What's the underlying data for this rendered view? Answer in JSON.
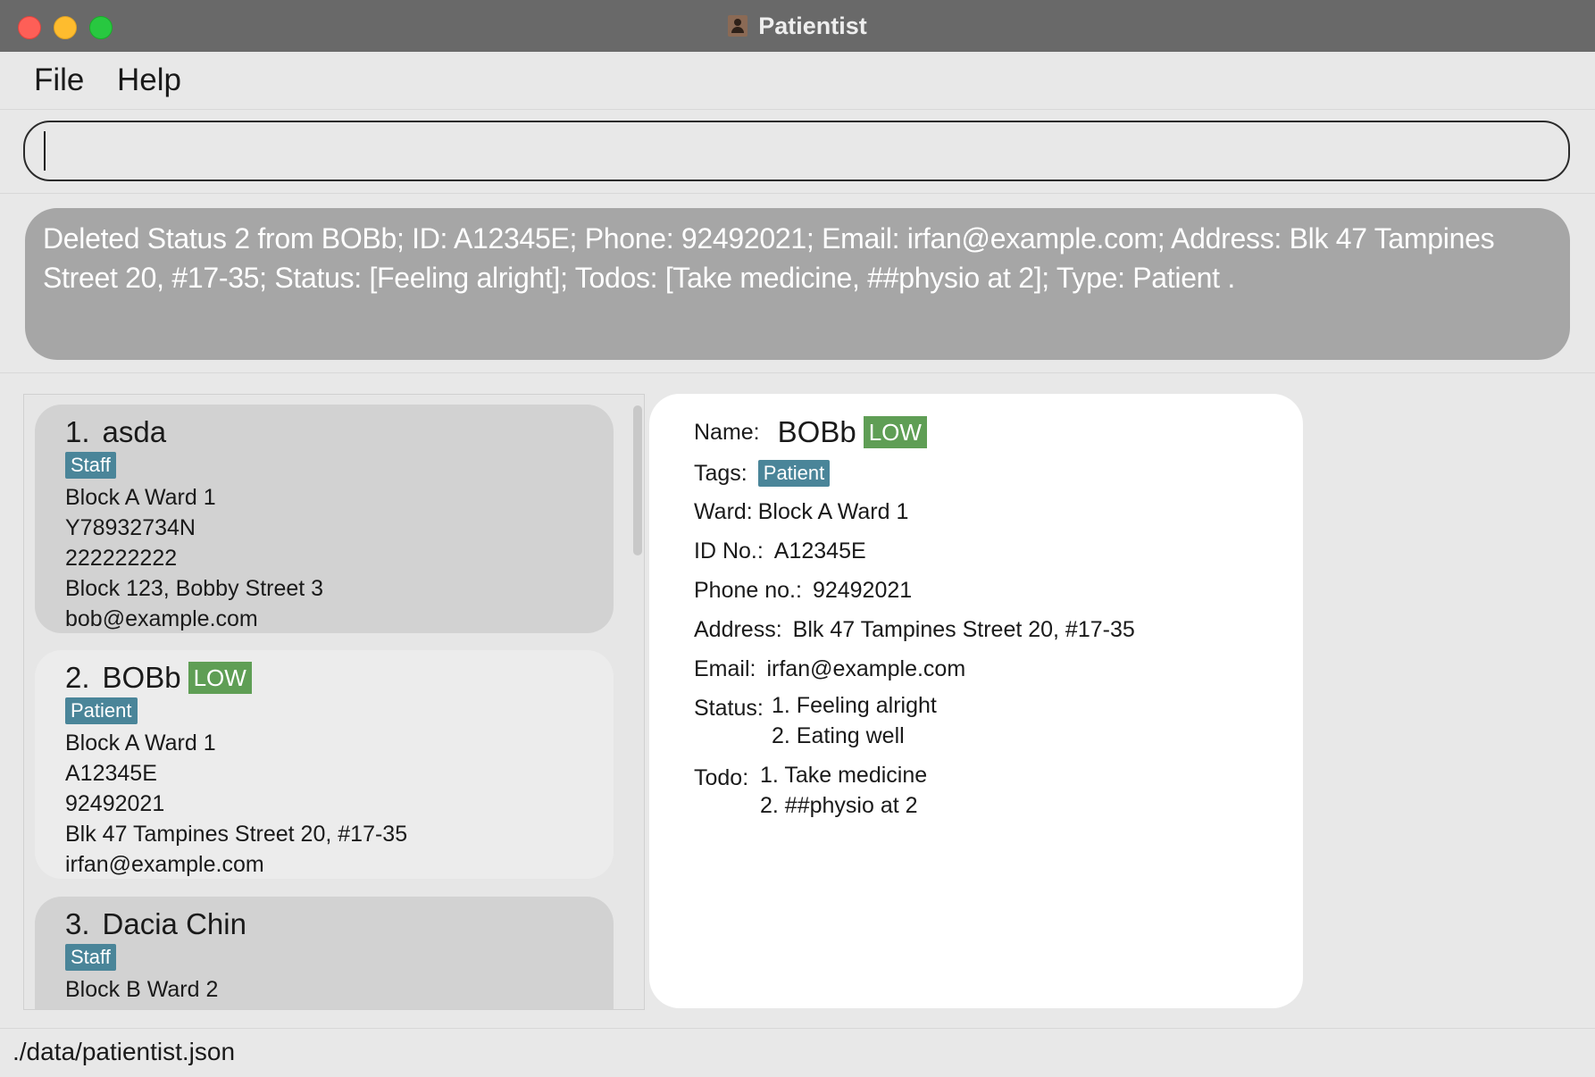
{
  "window": {
    "title": "Patientist"
  },
  "menu": {
    "file": "File",
    "help": "Help"
  },
  "command": {
    "value": "",
    "placeholder": ""
  },
  "result": {
    "message": "Deleted Status 2 from BOBb; ID: A12345E; Phone: 92492021; Email: irfan@example.com; Address: Blk 47 Tampines Street 20, #17-35; Status: [Feeling alright]; Todos: [Take medicine, ##physio at 2]; Type: Patient ."
  },
  "list": [
    {
      "index": "1.",
      "name": "asda",
      "priority": "",
      "tag": "Staff",
      "ward": "Block A Ward 1",
      "id": "Y78932734N",
      "phone": "222222222",
      "address": "Block 123, Bobby Street 3",
      "email": "bob@example.com"
    },
    {
      "index": "2.",
      "name": "BOBb",
      "priority": "LOW",
      "tag": "Patient",
      "ward": "Block A Ward 1",
      "id": "A12345E",
      "phone": "92492021",
      "address": "Blk 47 Tampines Street 20, #17-35",
      "email": "irfan@example.com"
    },
    {
      "index": "3.",
      "name": "Dacia Chin",
      "priority": "",
      "tag": "Staff",
      "ward": "Block B Ward 2",
      "id": "",
      "phone": "",
      "address": "",
      "email": ""
    }
  ],
  "detail": {
    "name_label": "Name:",
    "name": "BOBb",
    "priority": "LOW",
    "tags_label": "Tags:",
    "tag": "Patient",
    "ward_label": "Ward:",
    "ward": "Block A Ward 1",
    "id_label": "ID No.:",
    "id": "A12345E",
    "phone_label": "Phone no.:",
    "phone": "92492021",
    "address_label": "Address:",
    "address": "Blk 47 Tampines Street 20, #17-35",
    "email_label": "Email:",
    "email": "irfan@example.com",
    "status_label": "Status:",
    "status": [
      "1. Feeling alright",
      "2. Eating well"
    ],
    "todo_label": "Todo:",
    "todos": [
      "1. Take medicine",
      "2. ##physio at 2"
    ]
  },
  "status_bar": {
    "path": "./data/patientist.json"
  },
  "colors": {
    "title_bar": "#696969",
    "result_box": "#a6a6a6",
    "tag": "#4a8599",
    "priority_low": "#5f9e55",
    "card_odd": "#d2d2d2",
    "card_even": "#ececec"
  }
}
